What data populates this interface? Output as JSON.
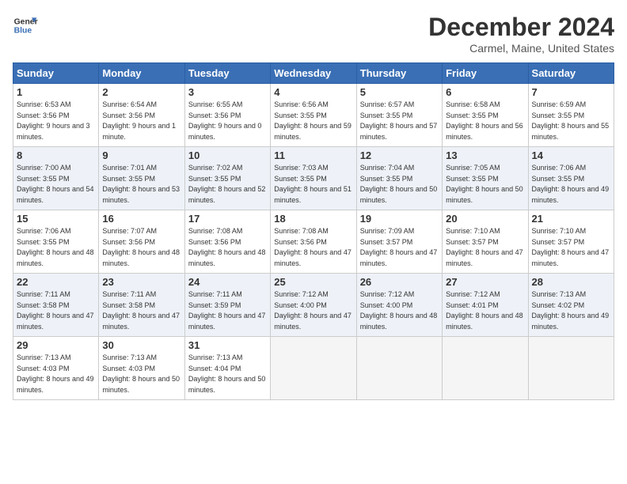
{
  "header": {
    "logo_line1": "General",
    "logo_line2": "Blue",
    "title": "December 2024",
    "location": "Carmel, Maine, United States"
  },
  "days_of_week": [
    "Sunday",
    "Monday",
    "Tuesday",
    "Wednesday",
    "Thursday",
    "Friday",
    "Saturday"
  ],
  "weeks": [
    [
      {
        "day": "1",
        "sunrise": "6:53 AM",
        "sunset": "3:56 PM",
        "daylight": "9 hours and 3 minutes."
      },
      {
        "day": "2",
        "sunrise": "6:54 AM",
        "sunset": "3:56 PM",
        "daylight": "9 hours and 1 minute."
      },
      {
        "day": "3",
        "sunrise": "6:55 AM",
        "sunset": "3:56 PM",
        "daylight": "9 hours and 0 minutes."
      },
      {
        "day": "4",
        "sunrise": "6:56 AM",
        "sunset": "3:55 PM",
        "daylight": "8 hours and 59 minutes."
      },
      {
        "day": "5",
        "sunrise": "6:57 AM",
        "sunset": "3:55 PM",
        "daylight": "8 hours and 57 minutes."
      },
      {
        "day": "6",
        "sunrise": "6:58 AM",
        "sunset": "3:55 PM",
        "daylight": "8 hours and 56 minutes."
      },
      {
        "day": "7",
        "sunrise": "6:59 AM",
        "sunset": "3:55 PM",
        "daylight": "8 hours and 55 minutes."
      }
    ],
    [
      {
        "day": "8",
        "sunrise": "7:00 AM",
        "sunset": "3:55 PM",
        "daylight": "8 hours and 54 minutes."
      },
      {
        "day": "9",
        "sunrise": "7:01 AM",
        "sunset": "3:55 PM",
        "daylight": "8 hours and 53 minutes."
      },
      {
        "day": "10",
        "sunrise": "7:02 AM",
        "sunset": "3:55 PM",
        "daylight": "8 hours and 52 minutes."
      },
      {
        "day": "11",
        "sunrise": "7:03 AM",
        "sunset": "3:55 PM",
        "daylight": "8 hours and 51 minutes."
      },
      {
        "day": "12",
        "sunrise": "7:04 AM",
        "sunset": "3:55 PM",
        "daylight": "8 hours and 50 minutes."
      },
      {
        "day": "13",
        "sunrise": "7:05 AM",
        "sunset": "3:55 PM",
        "daylight": "8 hours and 50 minutes."
      },
      {
        "day": "14",
        "sunrise": "7:06 AM",
        "sunset": "3:55 PM",
        "daylight": "8 hours and 49 minutes."
      }
    ],
    [
      {
        "day": "15",
        "sunrise": "7:06 AM",
        "sunset": "3:55 PM",
        "daylight": "8 hours and 48 minutes."
      },
      {
        "day": "16",
        "sunrise": "7:07 AM",
        "sunset": "3:56 PM",
        "daylight": "8 hours and 48 minutes."
      },
      {
        "day": "17",
        "sunrise": "7:08 AM",
        "sunset": "3:56 PM",
        "daylight": "8 hours and 48 minutes."
      },
      {
        "day": "18",
        "sunrise": "7:08 AM",
        "sunset": "3:56 PM",
        "daylight": "8 hours and 47 minutes."
      },
      {
        "day": "19",
        "sunrise": "7:09 AM",
        "sunset": "3:57 PM",
        "daylight": "8 hours and 47 minutes."
      },
      {
        "day": "20",
        "sunrise": "7:10 AM",
        "sunset": "3:57 PM",
        "daylight": "8 hours and 47 minutes."
      },
      {
        "day": "21",
        "sunrise": "7:10 AM",
        "sunset": "3:57 PM",
        "daylight": "8 hours and 47 minutes."
      }
    ],
    [
      {
        "day": "22",
        "sunrise": "7:11 AM",
        "sunset": "3:58 PM",
        "daylight": "8 hours and 47 minutes."
      },
      {
        "day": "23",
        "sunrise": "7:11 AM",
        "sunset": "3:58 PM",
        "daylight": "8 hours and 47 minutes."
      },
      {
        "day": "24",
        "sunrise": "7:11 AM",
        "sunset": "3:59 PM",
        "daylight": "8 hours and 47 minutes."
      },
      {
        "day": "25",
        "sunrise": "7:12 AM",
        "sunset": "4:00 PM",
        "daylight": "8 hours and 47 minutes."
      },
      {
        "day": "26",
        "sunrise": "7:12 AM",
        "sunset": "4:00 PM",
        "daylight": "8 hours and 48 minutes."
      },
      {
        "day": "27",
        "sunrise": "7:12 AM",
        "sunset": "4:01 PM",
        "daylight": "8 hours and 48 minutes."
      },
      {
        "day": "28",
        "sunrise": "7:13 AM",
        "sunset": "4:02 PM",
        "daylight": "8 hours and 49 minutes."
      }
    ],
    [
      {
        "day": "29",
        "sunrise": "7:13 AM",
        "sunset": "4:03 PM",
        "daylight": "8 hours and 49 minutes."
      },
      {
        "day": "30",
        "sunrise": "7:13 AM",
        "sunset": "4:03 PM",
        "daylight": "8 hours and 50 minutes."
      },
      {
        "day": "31",
        "sunrise": "7:13 AM",
        "sunset": "4:04 PM",
        "daylight": "8 hours and 50 minutes."
      },
      null,
      null,
      null,
      null
    ]
  ]
}
